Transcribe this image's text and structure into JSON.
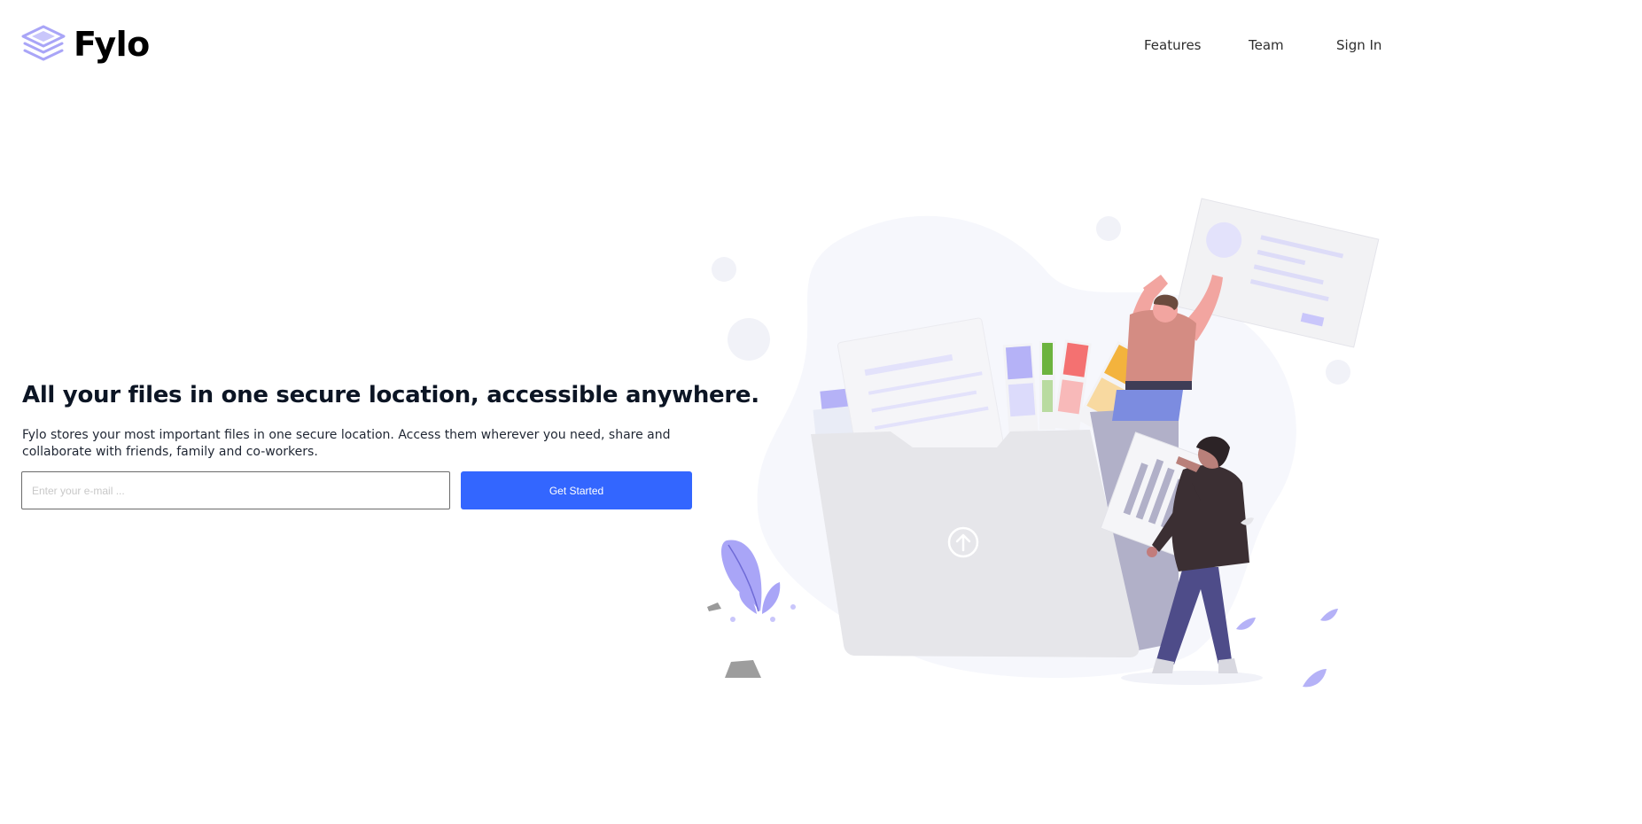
{
  "brand": {
    "name": "Fylo",
    "logo_icon": "layers-icon",
    "logo_color": "#a9a5f7"
  },
  "nav": {
    "items": [
      {
        "label": "Features"
      },
      {
        "label": "Team"
      },
      {
        "label": "Sign In"
      }
    ]
  },
  "hero": {
    "title": "All your files in one secure location, accessible anywhere.",
    "description": "Fylo stores your most important files in one secure location. Access them wherever you need, share and collaborate with friends, family and co-workers."
  },
  "signup": {
    "email_placeholder": "Enter your e-mail ...",
    "email_value": "",
    "button_label": "Get Started"
  },
  "illustration": {
    "name": "hero-illustration",
    "upload_icon": "upload-arrow-icon"
  },
  "colors": {
    "accent": "#3366ff",
    "text": "#0c1524",
    "input_border": "#6b6b6b"
  }
}
